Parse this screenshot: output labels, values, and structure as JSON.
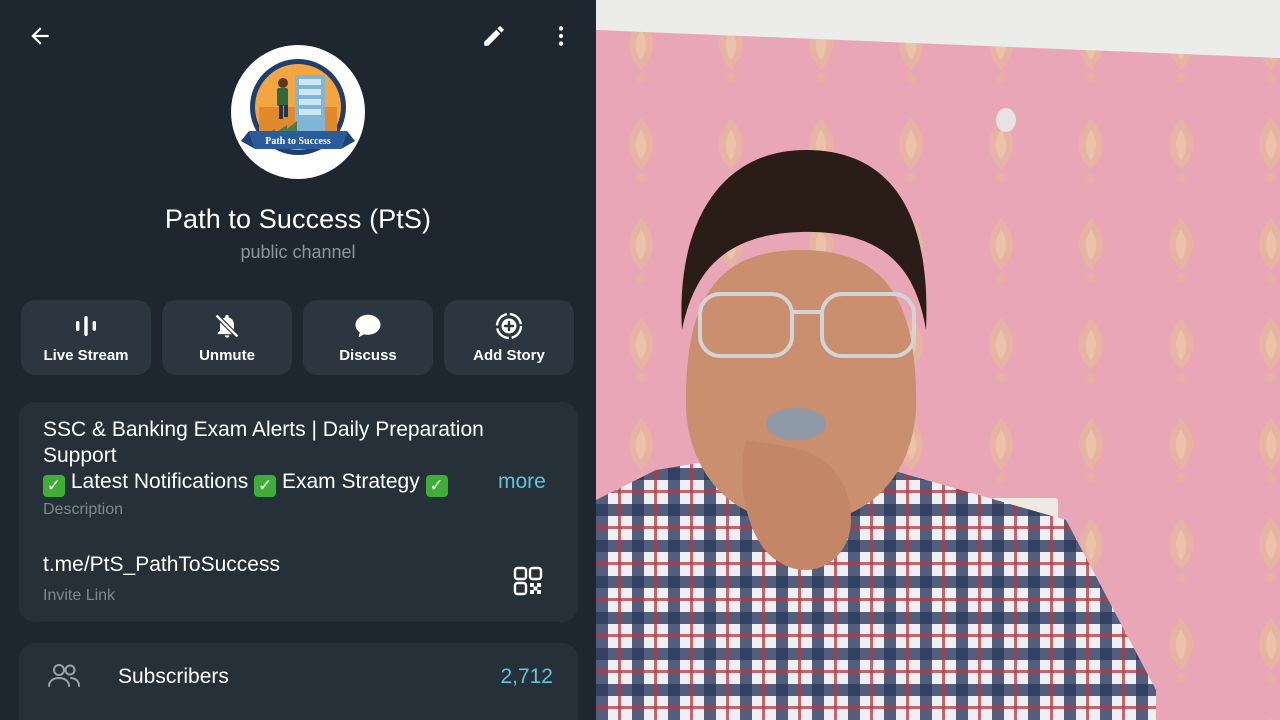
{
  "header": {
    "back_icon": "arrow-left-icon",
    "edit_icon": "pencil-icon",
    "menu_icon": "more-vertical-icon"
  },
  "channel": {
    "logo_text": "Path to Success",
    "title": "Path to Success (PtS)",
    "subtitle": "public channel"
  },
  "actions": [
    {
      "label": "Live Stream",
      "icon": "live-stream-icon"
    },
    {
      "label": "Unmute",
      "icon": "bell-off-icon"
    },
    {
      "label": "Discuss",
      "icon": "chat-bubble-icon"
    },
    {
      "label": "Add Story",
      "icon": "add-story-icon"
    }
  ],
  "description": {
    "line1": "SSC & Banking Exam Alerts | Daily Preparation",
    "line2": "Support",
    "line3_part1": "Latest Notifications",
    "line3_part2": "Exam Strategy",
    "check_glyph": "✓",
    "more_label": "more",
    "label": "Description"
  },
  "invite": {
    "link": "t.me/PtS_PathToSuccess",
    "label": "Invite Link",
    "icon": "qr-code-icon"
  },
  "subscribers": {
    "label": "Subscribers",
    "count": "2,712",
    "icon": "people-icon"
  },
  "colors": {
    "panel_bg": "#1e272f",
    "card_bg": "#263039",
    "button_bg": "#2b3640",
    "accent": "#5fc3d9",
    "secondary_text": "#8c969f"
  }
}
